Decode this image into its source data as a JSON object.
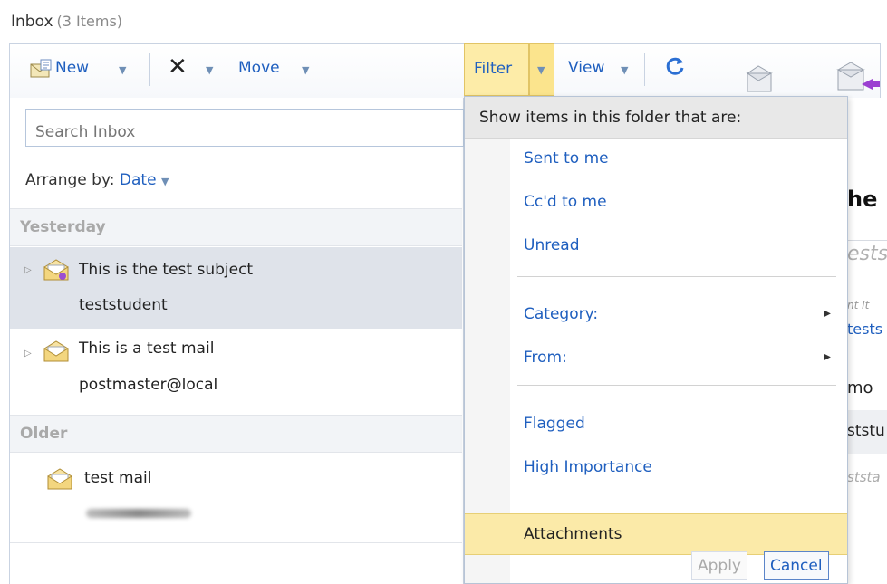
{
  "header": {
    "title": "Inbox",
    "count": "(3 Items)"
  },
  "toolbar": {
    "new_label": "New",
    "delete_icon": "close-icon",
    "move_label": "Move",
    "filter_label": "Filter",
    "view_label": "View",
    "refresh_icon": "refresh-icon"
  },
  "search": {
    "placeholder": "Search Inbox"
  },
  "arrange": {
    "label": "Arrange by:",
    "value": "Date"
  },
  "groups": [
    {
      "label": "Yesterday",
      "items": [
        {
          "subject": "This is the test subject",
          "from": "teststudent",
          "selected": true
        },
        {
          "subject": "This is a test mail",
          "from": "postmaster@local",
          "selected": false
        }
      ]
    },
    {
      "label": "Older",
      "items": [
        {
          "subject": "test mail",
          "from": "",
          "selected": false
        }
      ]
    }
  ],
  "filter_menu": {
    "header": "Show items in this folder that are:",
    "items": [
      {
        "label": "Sent to me"
      },
      {
        "label": "Cc'd to me"
      },
      {
        "label": "Unread"
      },
      {
        "label": "Category:",
        "submenu": true
      },
      {
        "label": "From:",
        "submenu": true
      },
      {
        "label": "Flagged"
      },
      {
        "label": "High Importance"
      },
      {
        "label": "Attachments",
        "highlighted": true
      }
    ],
    "apply_label": "Apply",
    "cancel_label": "Cancel"
  },
  "reading_pane": {
    "fragments": [
      "he",
      "ests",
      "nt It",
      "tests",
      "mo",
      "ststu",
      "ststa"
    ]
  },
  "colors": {
    "link": "#1f5fbf",
    "highlight": "#fbeaa8",
    "selected_row": "#dfe3ea"
  }
}
